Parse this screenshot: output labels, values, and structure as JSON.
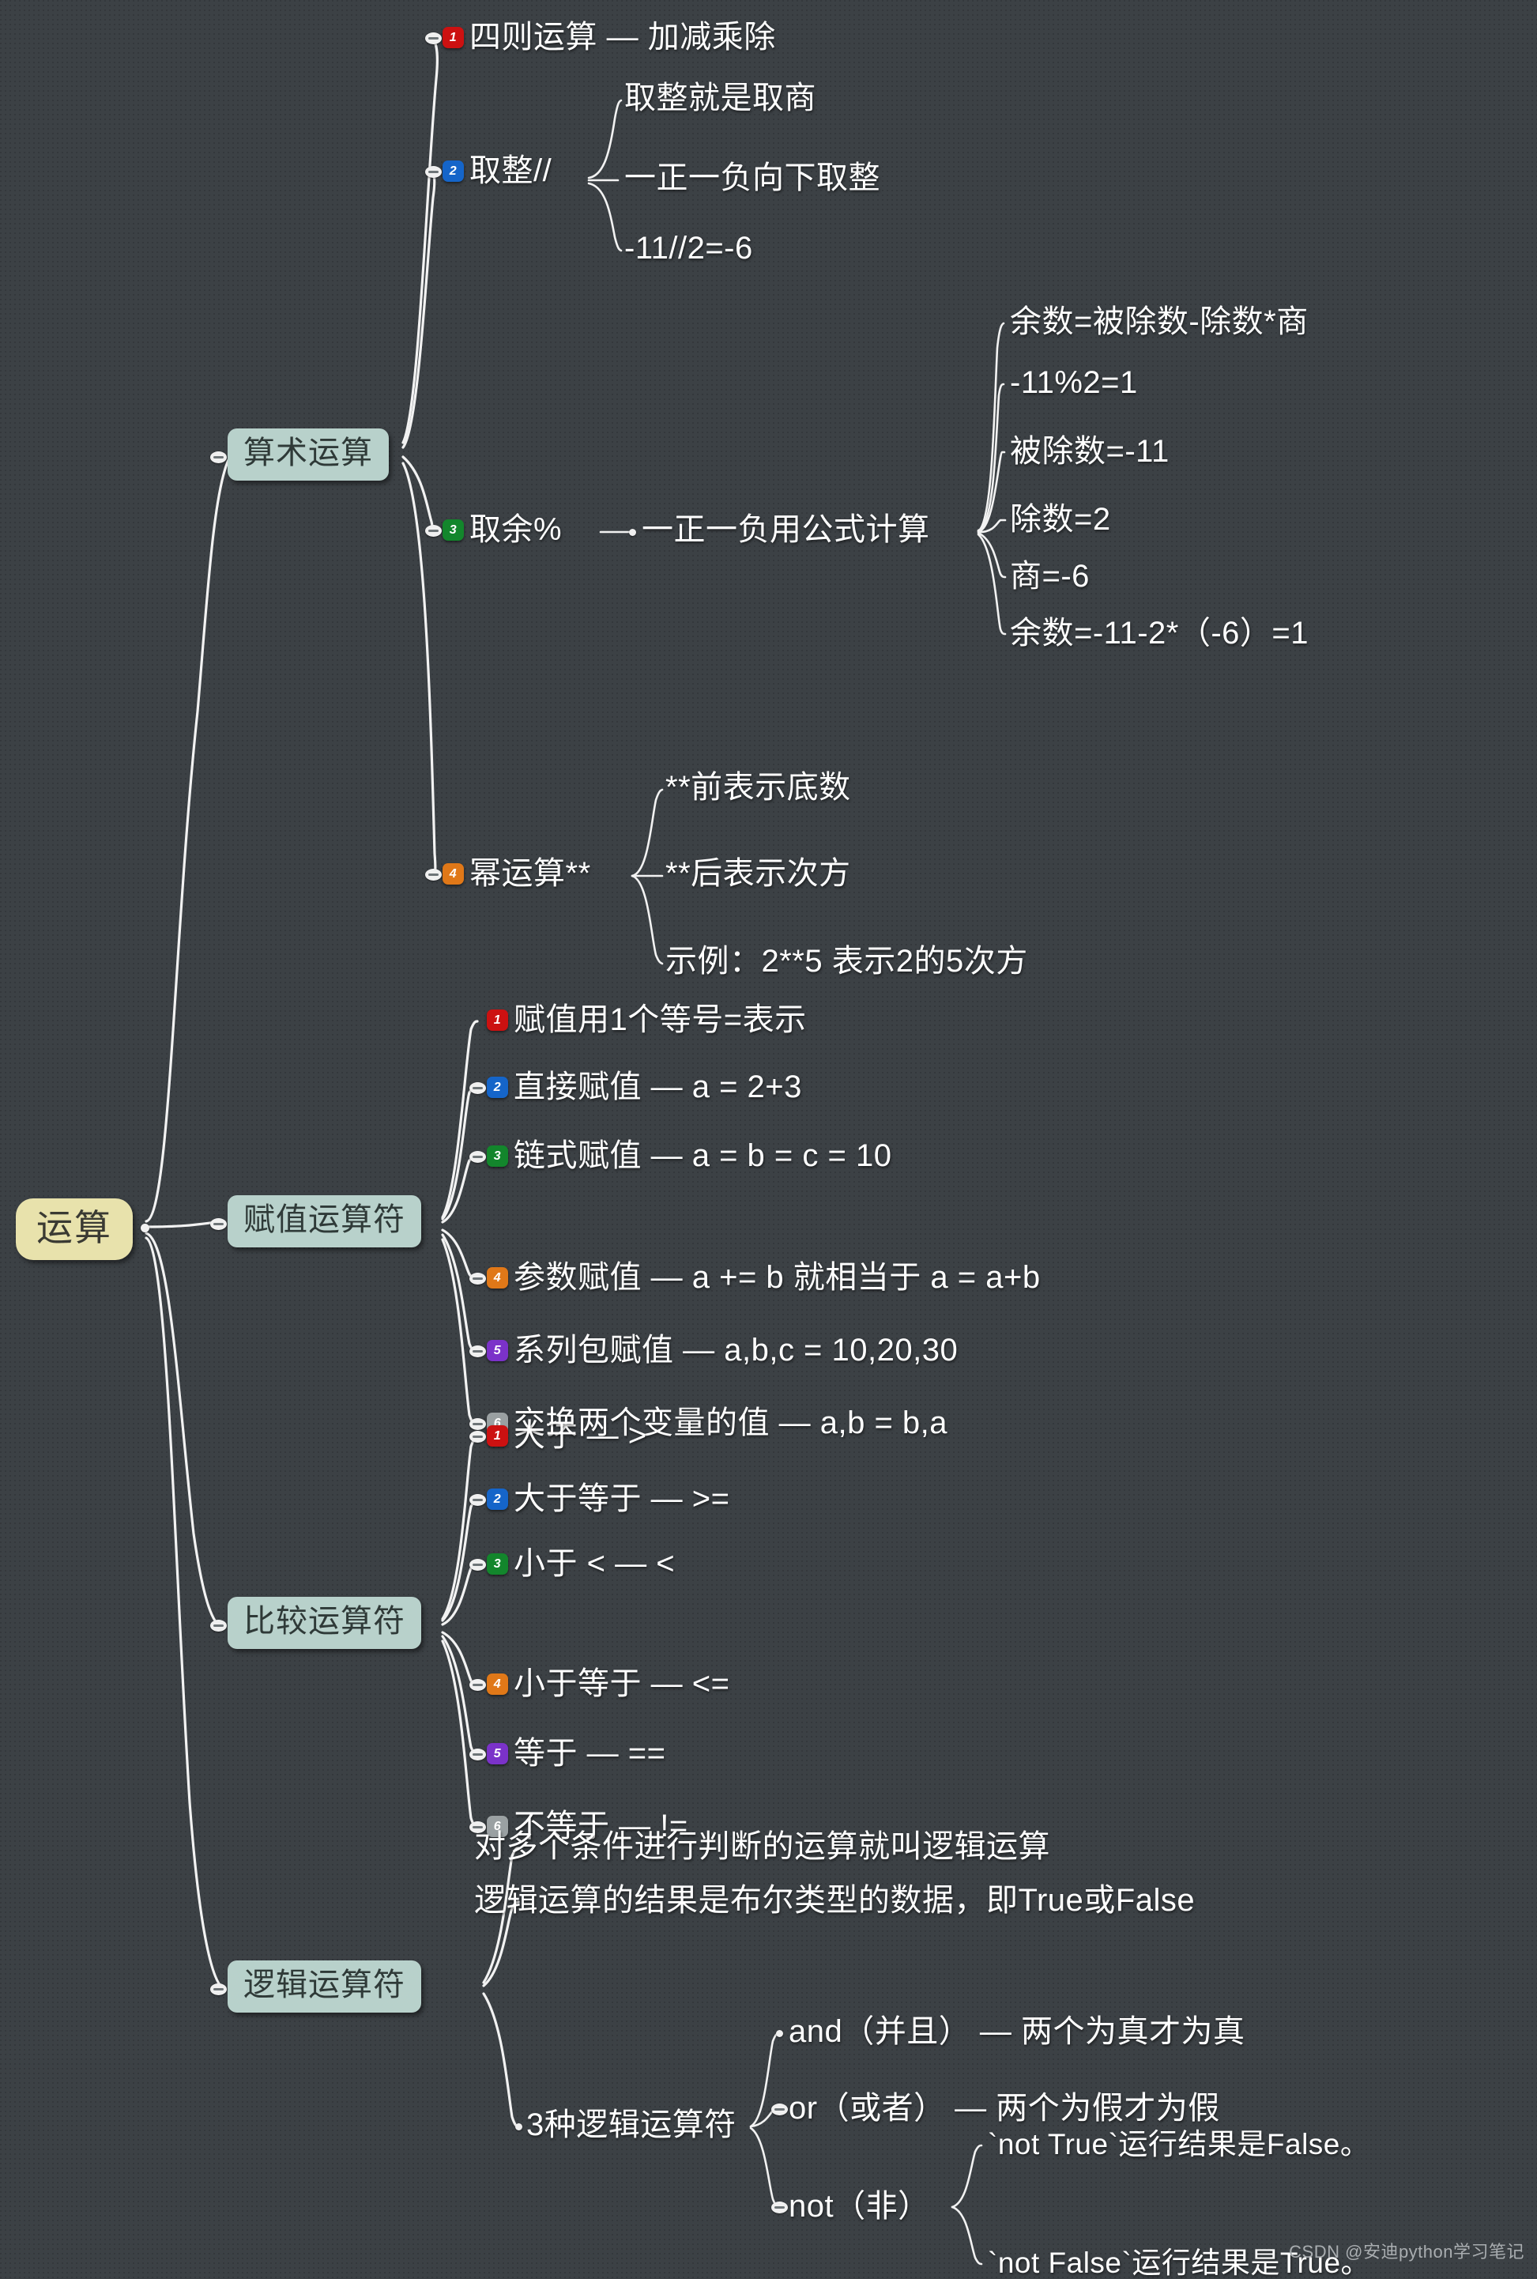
{
  "root": {
    "label": "运算"
  },
  "branches": [
    {
      "label": "算术运算"
    },
    {
      "label": "赋值运算符"
    },
    {
      "label": "比较运算符"
    },
    {
      "label": "逻辑运算符"
    }
  ],
  "arithmetic": {
    "items": [
      {
        "num": "1",
        "label": "四则运算 — 加减乘除"
      },
      {
        "num": "2",
        "label": "取整//"
      },
      {
        "num": "3",
        "label": "取余%"
      },
      {
        "num": "4",
        "label": "幂运算**"
      }
    ],
    "floordiv_children": [
      "取整就是取商",
      "一正一负向下取整",
      "-11//2=-6"
    ],
    "mod_child": "一正一负用公式计算",
    "mod_details": [
      "余数=被除数-除数*商",
      "-11%2=1",
      "被除数=-11",
      "除数=2",
      "商=-6",
      "余数=-11-2*（-6）=1"
    ],
    "power_children": [
      "**前表示底数",
      "**后表示次方",
      "示例：2**5 表示2的5次方"
    ]
  },
  "assignment": {
    "items": [
      {
        "num": "1",
        "label": "赋值用1个等号=表示"
      },
      {
        "num": "2",
        "label": "直接赋值 — a = 2+3"
      },
      {
        "num": "3",
        "label": "链式赋值 — a = b = c = 10"
      },
      {
        "num": "4",
        "label": "参数赋值 — a += b 就相当于 a = a+b"
      },
      {
        "num": "5",
        "label": "系列包赋值 — a,b,c = 10,20,30"
      },
      {
        "num": "6",
        "label": "交换两个变量的值 — a,b = b,a"
      }
    ]
  },
  "comparison": {
    "items": [
      {
        "num": "1",
        "label": "大于 — >"
      },
      {
        "num": "2",
        "label": "大于等于 — >="
      },
      {
        "num": "3",
        "label": "小于 < — <"
      },
      {
        "num": "4",
        "label": "小于等于 — <="
      },
      {
        "num": "5",
        "label": "等于   — =="
      },
      {
        "num": "6",
        "label": "不等于 — !="
      }
    ]
  },
  "logical": {
    "line1": "对多个条件进行判断的运算就叫逻辑运算",
    "line2": "逻辑运算的结果是布尔类型的数据，即True或False",
    "group_label": "3种逻辑运算符",
    "ops": [
      {
        "label": "and（并且） — 两个为真才为真"
      },
      {
        "label": "or（或者） — 两个为假才为假"
      },
      {
        "label": "not（非）"
      }
    ],
    "not_details": [
      "`not True`运行结果是False。",
      "`not False`运行结果是True。"
    ]
  },
  "watermark": "CSDN @安迪python学习笔记"
}
